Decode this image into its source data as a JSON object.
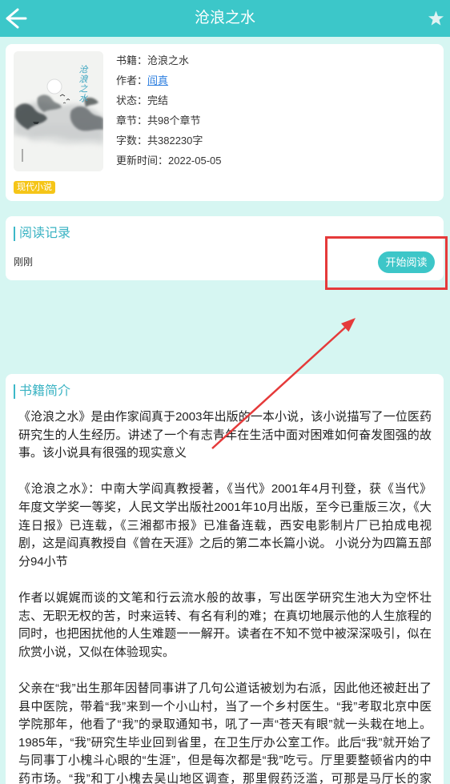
{
  "theme": {
    "primary": "#3cc7c9",
    "page_background": "#d6f6f2",
    "tag_background": "#f5c518",
    "link": "#2f80e0",
    "annotation": "#e53a3a"
  },
  "icons": {
    "back": "arrow-left-icon",
    "favorite": "star-icon"
  },
  "header": {
    "title": "沧浪之水"
  },
  "book": {
    "cover_title": "沧浪之水",
    "tag": "现代小说",
    "meta": [
      {
        "label": "书籍：",
        "value": "沧浪之水"
      },
      {
        "label": "作者：",
        "value": "阎真"
      },
      {
        "label": "状态：",
        "value": "完结"
      },
      {
        "label": "章节：",
        "value": "共98个章节"
      },
      {
        "label": "字数：",
        "value": "共382230字"
      },
      {
        "label": "更新时间：",
        "value": "2022-05-05"
      }
    ]
  },
  "reading_record": {
    "title": "阅读记录",
    "last_read": "刚刚",
    "start_button": "开始阅读"
  },
  "intro": {
    "title": "书籍简介",
    "paragraphs": [
      {
        "lines": [
          "《沧浪之水》是由作家阎真于2003年出版的一本小说，该小说描写了一位医药",
          "研究生的人生经历。讲述了一个有志青年在生活中面对困难如何奋发图强的故",
          "事。该小说具有很强的现实意义"
        ]
      },
      {
        "lines": [
          "《沧浪之水》：中南大学阎真教授著，《当代》2001年4月刊登，获《当代》",
          "年度文学奖一等奖，人民文学出版社2001年10月出版，至今已重版三次，《大",
          "连日报》已连载，《三湘都市报》已准备连载，西安电影制片厂已拍成电视",
          "剧，这是阎真教授自《曾在天涯》之后的第二本长篇小说。 小说分为四篇五部",
          "分94小节"
        ]
      },
      {
        "lines": [
          "作者以娓娓而谈的文笔和行云流水般的故事，写出医学研究生池大为空怀壮",
          "志、无职无权的苦，时来运转、有名有利的难；在真切地展示他的人生旅程的",
          "同时，也把困扰他的人生难题一一解开。读者在不知不觉中被深深吸引，似在",
          "欣赏小说，又似在体验现实。"
        ]
      },
      {
        "lines": [
          "父亲在“我”出生那年因替同事讲了几句公道话被划为右派，因此他还被赶出了",
          "县中医院，带着“我”来到一个小山村，当了一个乡村医生。“我”考取北京中医",
          "学院那年，他看了“我”的录取通知书，吼了一声“苍天有眼”就一头栽在地上。",
          "1985年，“我”研究生毕业回到省里，在卫生厅办公室工作。此后“我”就开始了",
          "与同事丁小槐斗心眼的“生涯”，但是每次都是“我”吃亏。厅里要整顿省内的中",
          "药市场。“我”和丁小槐去吴山地区调查，那里假药泛滥，可那是马厅长的家"
        ]
      }
    ]
  }
}
